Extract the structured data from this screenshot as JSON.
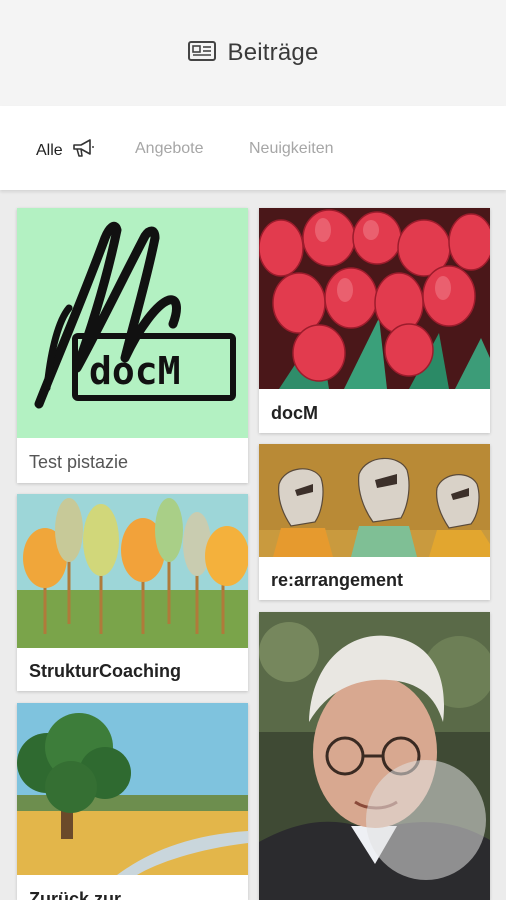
{
  "header": {
    "title": "Beiträge",
    "icon": "newspaper-icon"
  },
  "tabs": [
    {
      "label": "Alle",
      "icon": "megaphone-icon"
    },
    {
      "label": "Angebote"
    },
    {
      "label": "Neuigkeiten"
    }
  ],
  "posts": [
    {
      "title": "Test pistazie",
      "image": "docm-logo"
    },
    {
      "title": "docM",
      "image": "red-tulips-painting"
    },
    {
      "title": "re:arrangement",
      "image": "statue-heads-painting"
    },
    {
      "title": "StrukturCoaching",
      "image": "autumn-trees-painting"
    },
    {
      "title": "Zurück zur",
      "image": "landscape-tree-painting"
    },
    {
      "title": "",
      "image": "portrait-photo"
    }
  ],
  "logo_text": "docM",
  "colors": {
    "pistachio": "#b3f1c2",
    "text": "#222222",
    "muted": "#a6a6a6",
    "background": "#ececec"
  }
}
